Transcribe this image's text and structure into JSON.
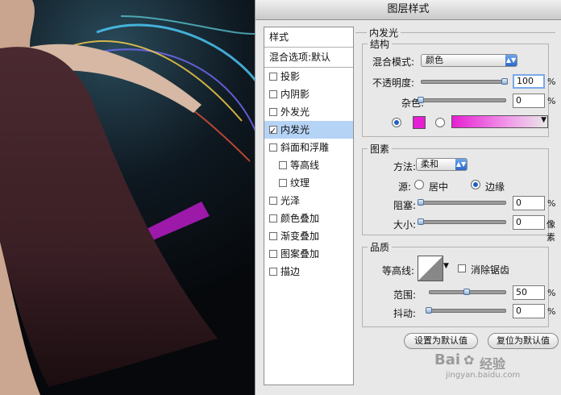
{
  "dialog": {
    "title": "图层样式",
    "sidebar": {
      "header": "样式",
      "blend_item": "混合选项:默认",
      "items": [
        {
          "label": "投影",
          "checked": false,
          "sub": false
        },
        {
          "label": "内阴影",
          "checked": false,
          "sub": false
        },
        {
          "label": "外发光",
          "checked": false,
          "sub": false
        },
        {
          "label": "内发光",
          "checked": true,
          "sub": false,
          "selected": true
        },
        {
          "label": "斜面和浮雕",
          "checked": false,
          "sub": false
        },
        {
          "label": "等高线",
          "checked": false,
          "sub": true
        },
        {
          "label": "纹理",
          "checked": false,
          "sub": true
        },
        {
          "label": "光泽",
          "checked": false,
          "sub": false
        },
        {
          "label": "颜色叠加",
          "checked": false,
          "sub": false
        },
        {
          "label": "渐变叠加",
          "checked": false,
          "sub": false
        },
        {
          "label": "图案叠加",
          "checked": false,
          "sub": false
        },
        {
          "label": "描边",
          "checked": false,
          "sub": false
        }
      ]
    },
    "panel_title": "内发光",
    "structure": {
      "legend": "结构",
      "blend_mode_label": "混合模式:",
      "blend_mode_value": "颜色",
      "opacity_label": "不透明度:",
      "opacity_value": "100",
      "opacity_unit": "%",
      "opacity_level": 1.0,
      "noise_label": "杂色:",
      "noise_value": "0",
      "noise_unit": "%",
      "noise_level": 0,
      "swatch_color": "#e61fd2"
    },
    "elements": {
      "legend": "图素",
      "technique_label": "方法:",
      "technique_value": "柔和",
      "source_label": "源:",
      "source_center": "居中",
      "source_edge": "边缘",
      "choke_label": "阻塞:",
      "choke_value": "0",
      "choke_unit": "%",
      "size_label": "大小:",
      "size_value": "0",
      "size_unit": "像素"
    },
    "quality": {
      "legend": "品质",
      "contour_label": "等高线:",
      "antialias_label": "消除锯齿",
      "range_label": "范围:",
      "range_value": "50",
      "range_unit": "%",
      "range_level": 0.5,
      "jitter_label": "抖动:",
      "jitter_value": "0",
      "jitter_unit": "%"
    },
    "buttons": {
      "make_default": "设置为默认值",
      "reset_default": "复位为默认值"
    }
  },
  "watermark": {
    "brand": "Bai",
    "mark": "经验",
    "url": "jingyan.baidu.com"
  },
  "colors": {
    "accent": "#2c69c8",
    "glow": "#e61fd2"
  }
}
